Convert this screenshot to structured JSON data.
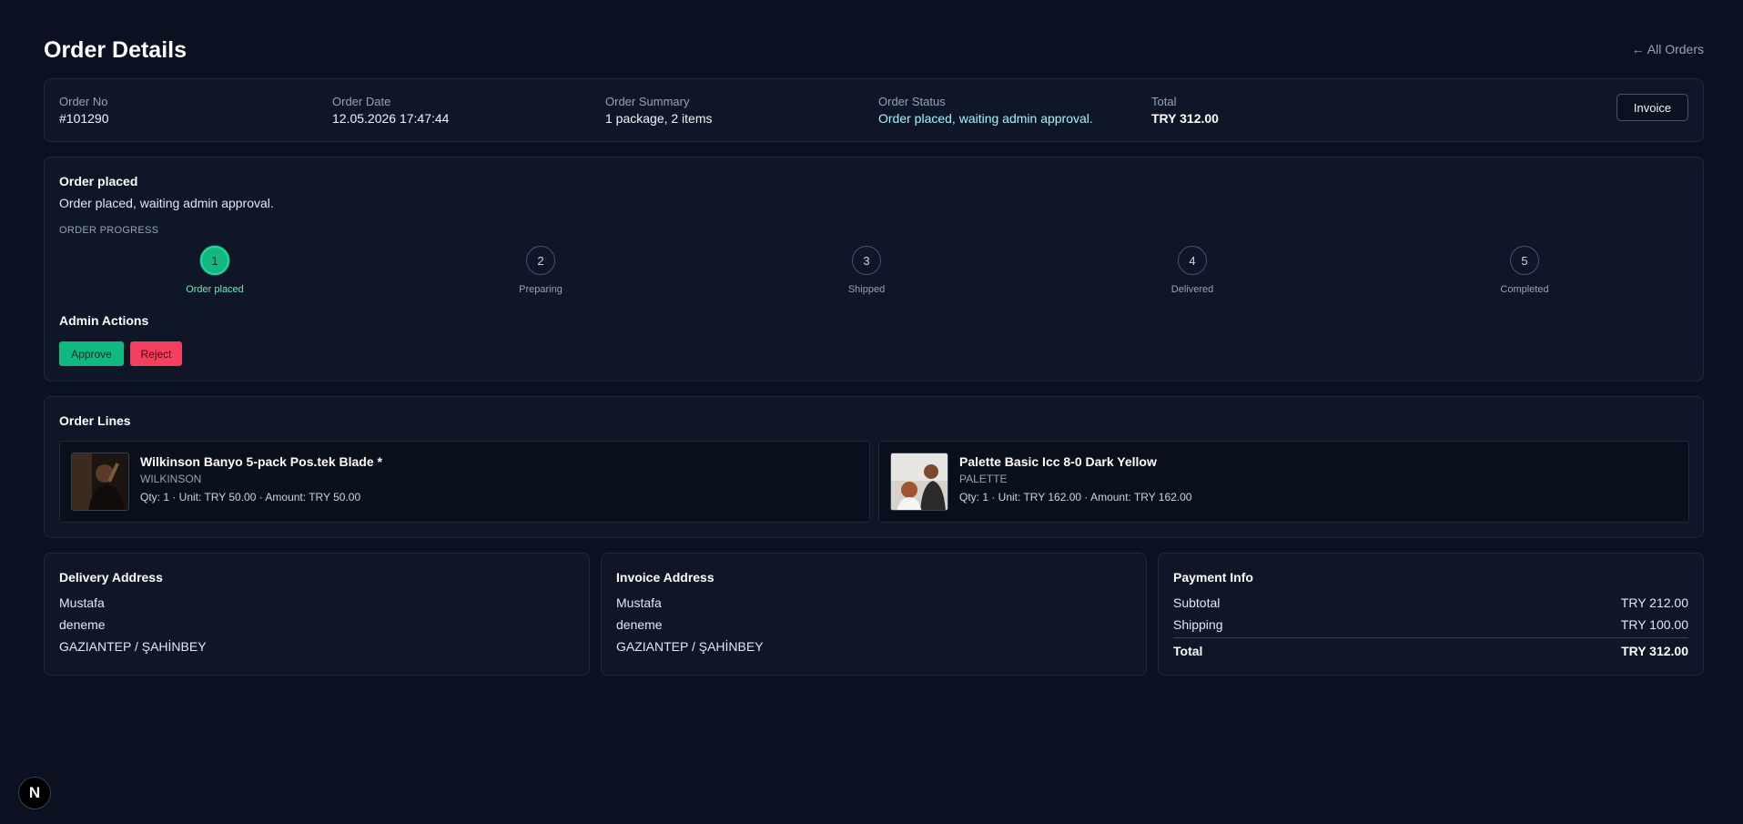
{
  "page": {
    "title": "Order Details",
    "back_link": "← All Orders"
  },
  "summary": {
    "order_no_label": "Order No",
    "order_no": "#101290",
    "order_date_label": "Order Date",
    "order_date": "12.05.2026 17:47:44",
    "summary_label": "Order Summary",
    "summary_value": "1 package, 2 items",
    "status_label": "Order Status",
    "status_value": "Order placed, waiting admin approval.",
    "total_label": "Total",
    "total_value": "TRY 312.00",
    "invoice_button": "Invoice"
  },
  "progress": {
    "title": "Order placed",
    "description": "Order placed, waiting admin approval.",
    "caption": "ORDER PROGRESS",
    "active_step": 1,
    "steps": [
      {
        "number": "1",
        "label": "Order placed"
      },
      {
        "number": "2",
        "label": "Preparing"
      },
      {
        "number": "3",
        "label": "Shipped"
      },
      {
        "number": "4",
        "label": "Delivered"
      },
      {
        "number": "5",
        "label": "Completed"
      }
    ],
    "admin_title": "Admin Actions",
    "approve_label": "Approve",
    "reject_label": "Reject"
  },
  "order_lines": {
    "title": "Order Lines",
    "items": [
      {
        "name": "Wilkinson Banyo 5-pack Pos.tek Blade *",
        "brand": "WILKINSON",
        "meta": "Qty: 1 · Unit: TRY 50.00 · Amount: TRY 50.00"
      },
      {
        "name": "Palette Basic Icc 8-0 Dark Yellow",
        "brand": "PALETTE",
        "meta": "Qty: 1 · Unit: TRY 162.00 · Amount: TRY 162.00"
      }
    ]
  },
  "delivery_address": {
    "title": "Delivery Address",
    "lines": [
      "Mustafa",
      "deneme",
      "GAZIANTEP / ŞAHİNBEY"
    ]
  },
  "invoice_address": {
    "title": "Invoice Address",
    "lines": [
      "Mustafa",
      "deneme",
      "GAZIANTEP / ŞAHİNBEY"
    ]
  },
  "payment": {
    "title": "Payment Info",
    "subtotal_label": "Subtotal",
    "subtotal_value": "TRY 212.00",
    "shipping_label": "Shipping",
    "shipping_value": "TRY 100.00",
    "total_label": "Total",
    "total_value": "TRY 312.00"
  },
  "badge": {
    "letter": "N",
    "icon": "nextjs-logo-icon"
  },
  "colors": {
    "background": "#0b1120",
    "card": "#0e1628",
    "accent_green": "#10b981",
    "reject_red": "#f43f5e",
    "status_cyan": "#a5f3fc"
  }
}
